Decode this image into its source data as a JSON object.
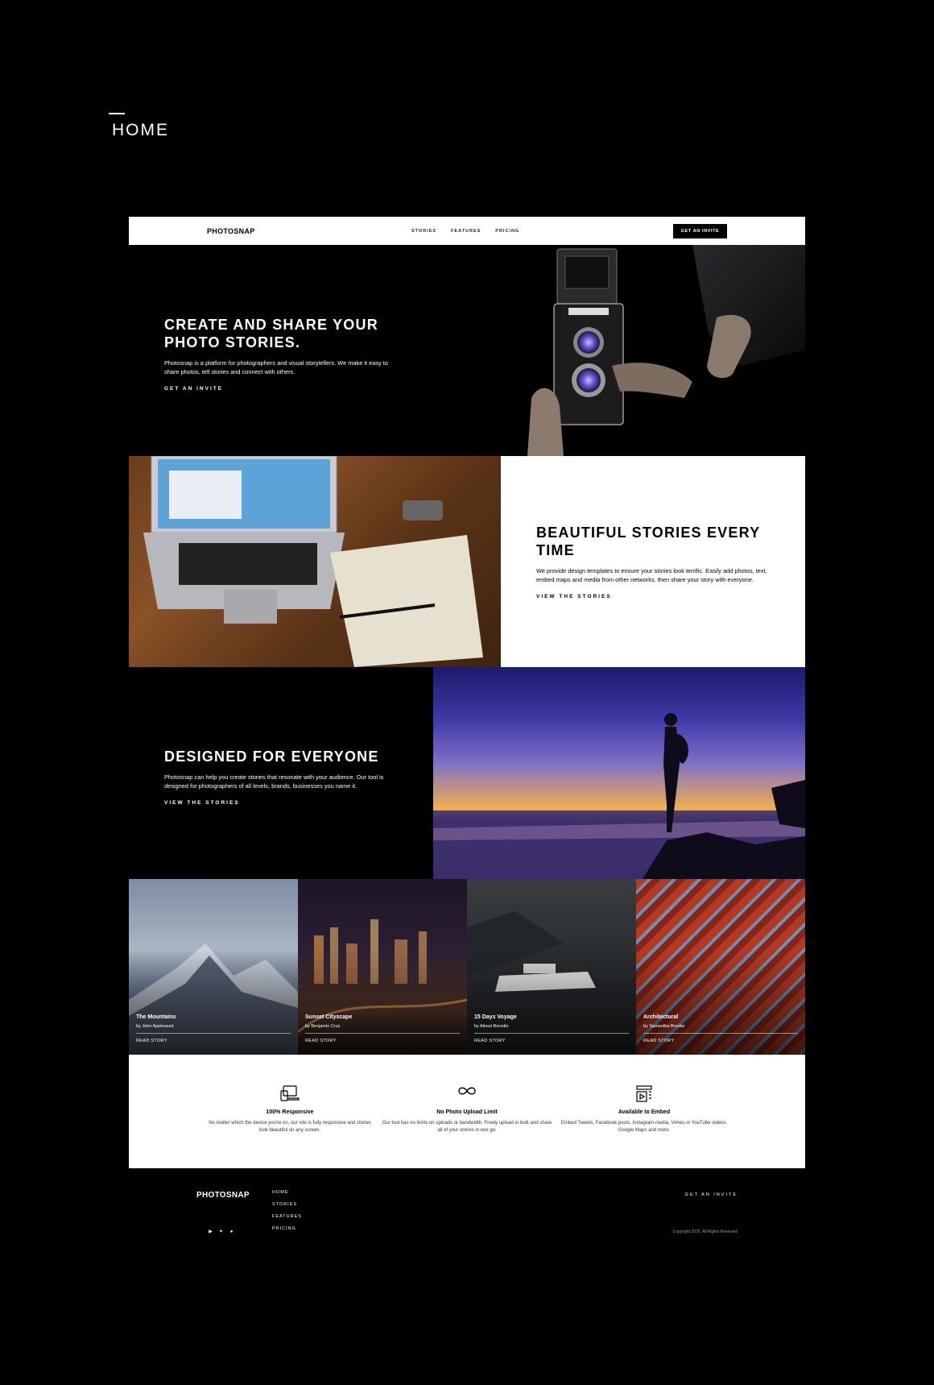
{
  "page_label": "HOME",
  "nav": {
    "logo": "PHOTOSNAP",
    "links": [
      "STORIES",
      "FEATURES",
      "PRICING"
    ],
    "cta": "GET AN INVITE"
  },
  "hero": {
    "title": "CREATE AND SHARE YOUR PHOTO STORIES.",
    "body": "Photosnap is a platform for photographers and visual storytellers. We make it easy to share photos, tell stories and connect with others.",
    "link": "GET AN INVITE"
  },
  "section2": {
    "title": "BEAUTIFUL STORIES EVERY TIME",
    "body": "We provide design templates to ensure your stories look terrific. Easily add photos, text, embed maps and media from other networks. then share your story with everyone.",
    "link": "VIEW THE STORIES"
  },
  "section3": {
    "title": "DESIGNED FOR EVERYONE",
    "body": "Photosnap can help you create stories that resonate with your audience. Our tool is designed for photographers of all levels, brands, businesses you name it.",
    "link": "VIEW THE STORIES"
  },
  "stories": [
    {
      "title": "The Mountains",
      "author": "by John Appleseed",
      "link": "READ STORY",
      "color": "#5b6b85"
    },
    {
      "title": "Sunset Cityscape",
      "author": "by Benjamin Cruz",
      "link": "READ STORY",
      "color": "#2a1f33"
    },
    {
      "title": "15 Days Voyage",
      "author": "by Alexei Borodin",
      "link": "READ STORY",
      "color": "#1f2226"
    },
    {
      "title": "Architectural",
      "author": "by Samantha Brooke",
      "link": "READ STORY",
      "color": "#8a2416"
    }
  ],
  "features": [
    {
      "icon": "devices-icon",
      "title": "100% Responsive",
      "desc": "No matter which the device you're on, our site is fully responsive and stories look beautiful on any screen."
    },
    {
      "icon": "infinity-icon",
      "title": "No Photo Upload Limit",
      "desc": "Our tool has no limits on uploads or bandwidth. Freely upload in bulk and share all of your stories in one go."
    },
    {
      "icon": "embed-icon",
      "title": "Available to Embed",
      "desc": "Embed Tweets, Facebook posts, Instagram media, Vimeo or YouTube videos, Google Maps and more."
    }
  ],
  "footer": {
    "logo": "PHOTOSNAP",
    "social": [
      "youtube-icon",
      "twitter-icon",
      "pinterest-icon"
    ],
    "links": [
      "HOME",
      "STORIES",
      "FEATURES",
      "PRICING"
    ],
    "invite": "GET AN INVITE",
    "copyright": "Copyright 2020. All Rights Reserved"
  }
}
